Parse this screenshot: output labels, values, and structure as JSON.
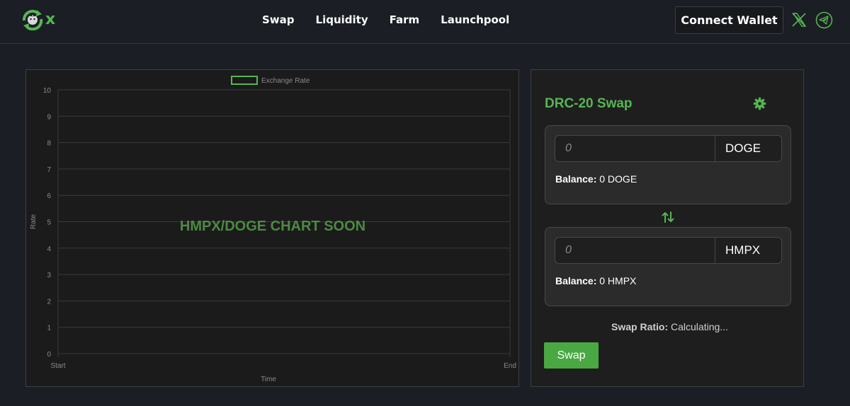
{
  "header": {
    "logo_text": "x",
    "nav": [
      "Swap",
      "Liquidity",
      "Farm",
      "Launchpool"
    ],
    "connect_label": "Connect Wallet"
  },
  "chart": {
    "overlay_text": "HMPX/DOGE CHART SOON"
  },
  "chart_data": {
    "type": "line",
    "title": "",
    "legend": [
      "Exchange Rate"
    ],
    "legend_placement": "top-center",
    "xlabel": "Time",
    "ylabel": "Rate",
    "categories": [
      "Start",
      "End"
    ],
    "series": [
      {
        "name": "Exchange Rate",
        "values": [],
        "color": "#56b652"
      }
    ],
    "ylim": [
      0,
      10
    ],
    "yticks": [
      "0",
      "1",
      "2",
      "3",
      "4",
      "5",
      "6",
      "7",
      "8",
      "9",
      "10"
    ],
    "grid": true
  },
  "swap": {
    "title": "DRC-20 Swap",
    "from": {
      "placeholder": "0",
      "token": "DOGE",
      "balance_label": "Balance:",
      "balance_value": "0 DOGE"
    },
    "to": {
      "placeholder": "0",
      "token": "HMPX",
      "balance_label": "Balance:",
      "balance_value": "0 HMPX"
    },
    "ratio_label": "Swap Ratio:",
    "ratio_value": "Calculating...",
    "button_label": "Swap"
  },
  "colors": {
    "accent": "#56b652",
    "background": "#1b1e24",
    "panel": "#1e1e1f"
  }
}
